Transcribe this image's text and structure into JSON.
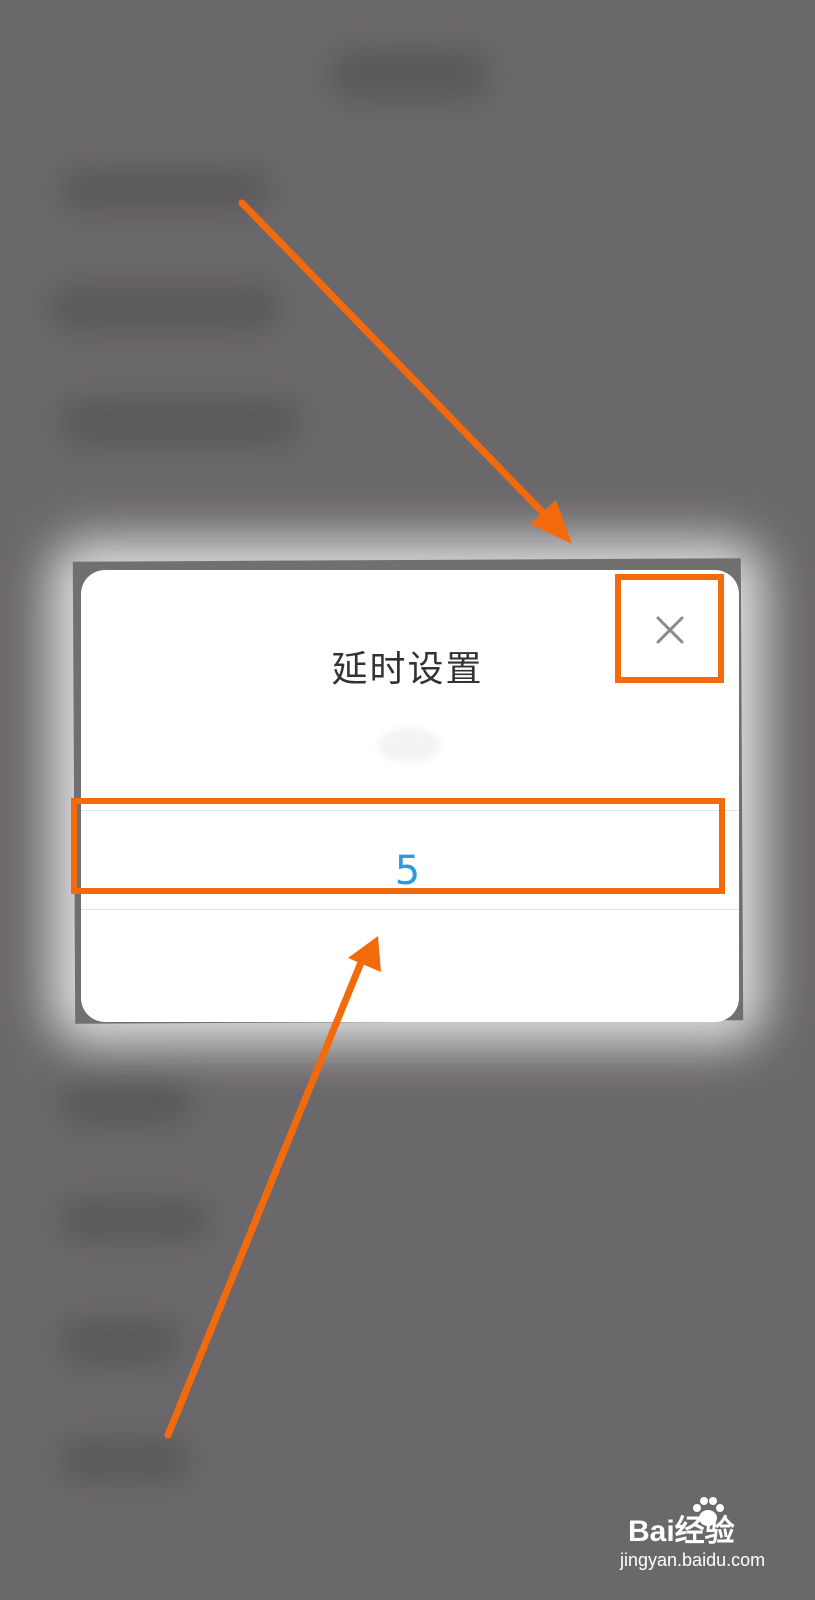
{
  "dialog": {
    "title": "延时设置",
    "value": "5",
    "close_icon": "close-icon"
  },
  "colors": {
    "annotation": "#f36a0c",
    "value_text": "#2b9bdc",
    "backdrop": "#6b686b"
  },
  "watermark": {
    "brand": "Bai经验",
    "url": "jingyan.baidu.com"
  }
}
